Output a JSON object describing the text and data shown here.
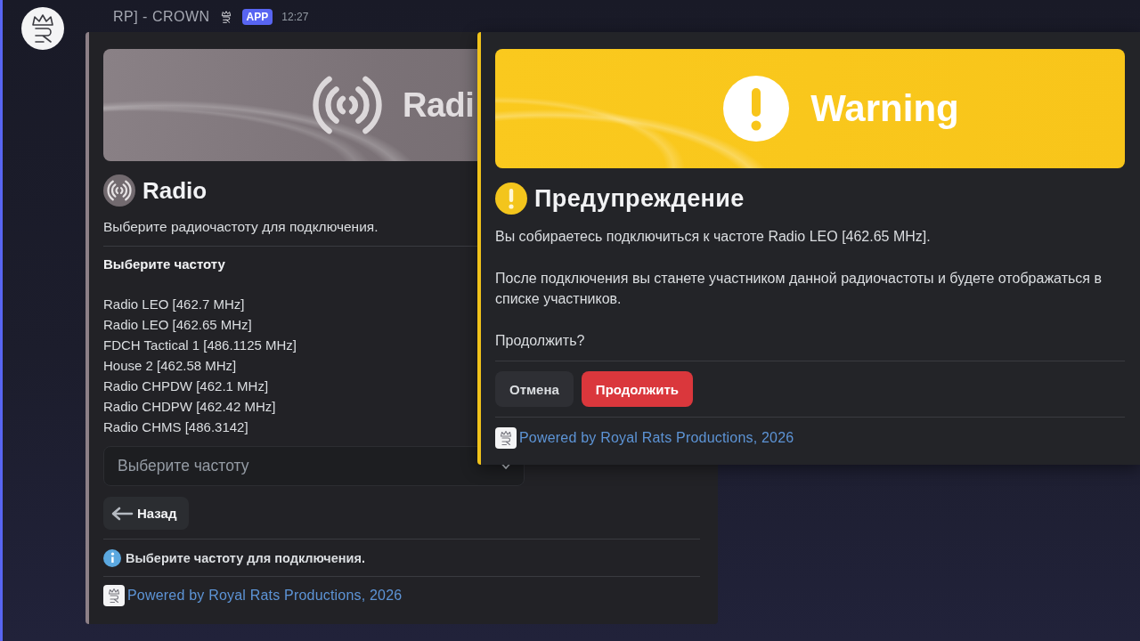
{
  "app_header": {
    "name": "RP] - CROWN",
    "badge": "APP",
    "time": "12:27"
  },
  "radio_card": {
    "banner_title": "Radi",
    "title": "Radio",
    "description": "Выберите радиочастоту для подключения.",
    "list_heading": "Выберите частоту",
    "frequencies": [
      "Radio LEO [462.7 MHz]",
      "Radio LEO [462.65 MHz]",
      "FDCH Tactical 1 [486.1125 MHz]",
      "House 2 [462.58 MHz]",
      "Radio CHPDW [462.1 MHz]",
      "Radio CHDPW [462.42 MHz]",
      "Radio CHMS [486.3142]"
    ],
    "select": {
      "placeholder": "Выберите частоту"
    },
    "back_button": {
      "label": "Назад"
    },
    "info": "Выберите частоту для подключения.",
    "footer": "Powered by Royal Rats Productions, 2026"
  },
  "warning_dialog": {
    "banner_title": "Warning",
    "title": "Предупреждение",
    "paragraphs": [
      "Вы собираетесь подключиться к частоте Radio LEO [462.65 MHz].",
      "После подключения вы станете участником данной радиочастоты и будете отображаться в списке участников.",
      "Продолжить?"
    ],
    "buttons": [
      {
        "label": "Отмена",
        "kind": "secondary"
      },
      {
        "label": "Продолжить",
        "kind": "danger"
      }
    ],
    "footer": "Powered by Royal Rats Productions, 2026"
  }
}
